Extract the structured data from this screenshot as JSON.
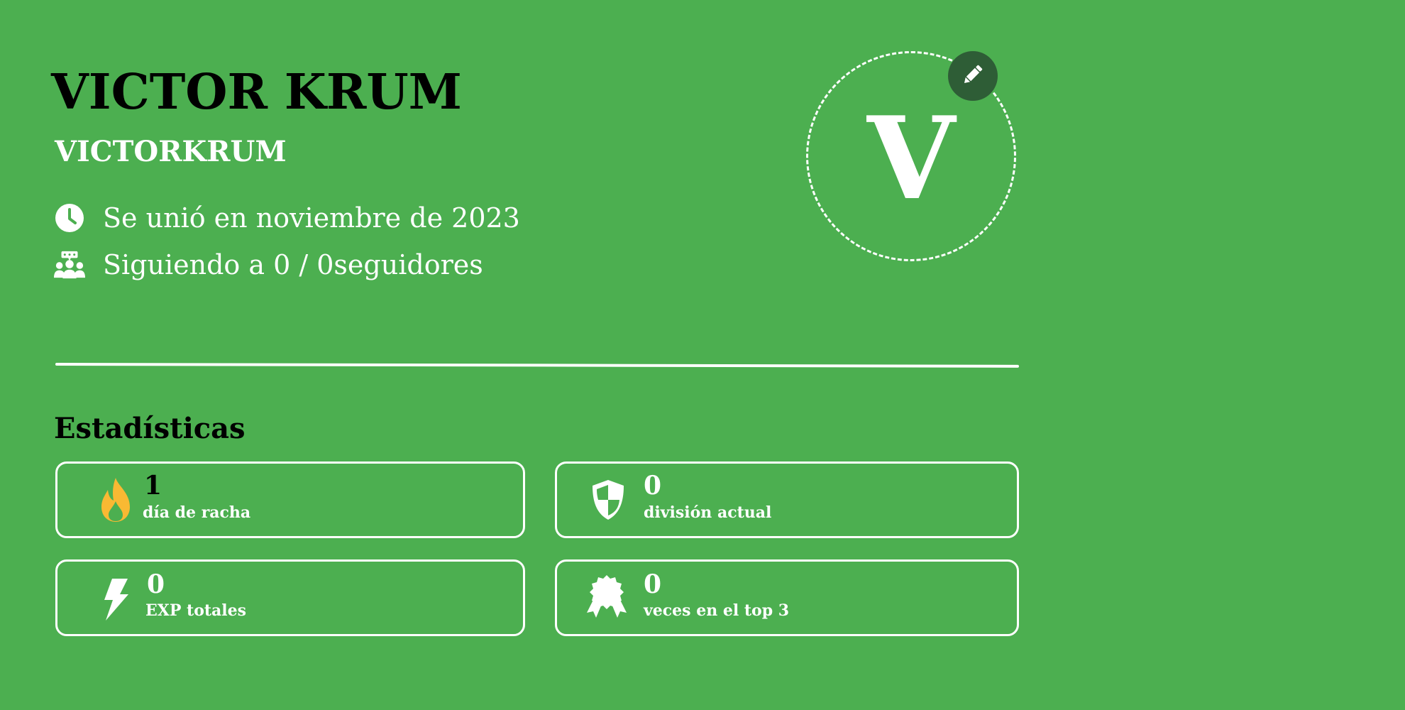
{
  "profile": {
    "name": "VICTOR KRUM",
    "username": "VICTORKRUM",
    "joined": "Se unió en noviembre de 2023",
    "following": "Siguiendo a 0 / 0seguidores",
    "avatar_initial": "V"
  },
  "icons": {
    "joined": "clock-icon",
    "following": "users-icon",
    "edit": "pencil-icon",
    "streak": "fire-icon",
    "division": "shield-icon",
    "exp": "lightning-icon",
    "top3": "award-icon"
  },
  "stats": {
    "title": "Estadísticas",
    "items": [
      {
        "value": "1",
        "label": "día de racha"
      },
      {
        "value": "0",
        "label": "división actual"
      },
      {
        "value": "0",
        "label": "EXP totales"
      },
      {
        "value": "0",
        "label": "veces en el top 3"
      }
    ]
  },
  "colors": {
    "background": "#4caf50",
    "edit_button": "#2e5d36",
    "flame": "#f9b933",
    "text_dark": "#000000",
    "text_light": "#ffffff"
  }
}
